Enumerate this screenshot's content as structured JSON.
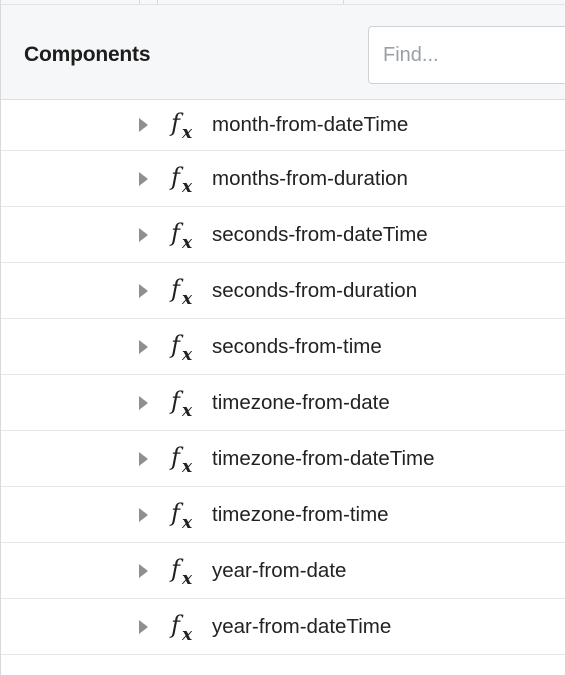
{
  "panel": {
    "title": "Components",
    "search": {
      "placeholder": "Find...",
      "value": ""
    }
  },
  "icons": {
    "expand": "caret-right-icon",
    "function": "function-fx-icon"
  },
  "components": [
    {
      "label": "month-from-dateTime"
    },
    {
      "label": "months-from-duration"
    },
    {
      "label": "seconds-from-dateTime"
    },
    {
      "label": "seconds-from-duration"
    },
    {
      "label": "seconds-from-time"
    },
    {
      "label": "timezone-from-date"
    },
    {
      "label": "timezone-from-dateTime"
    },
    {
      "label": "timezone-from-time"
    },
    {
      "label": "year-from-date"
    },
    {
      "label": "year-from-dateTime"
    }
  ]
}
